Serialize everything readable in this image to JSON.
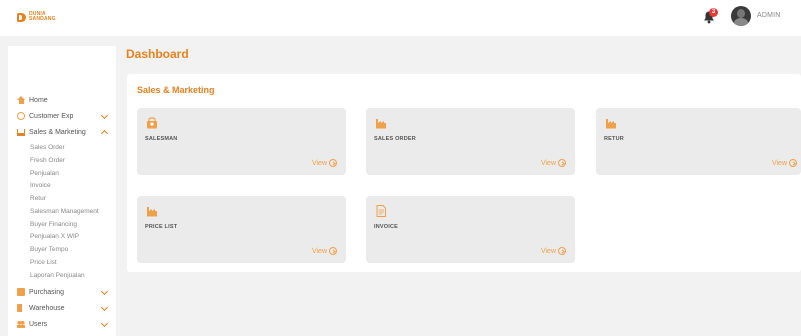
{
  "brand": {
    "line1": "DUNIA",
    "line2": "SANDANG",
    "accent": "#e8811f"
  },
  "header": {
    "notification_count": "3",
    "user_label": "ADMIN"
  },
  "sidebar": {
    "items": [
      {
        "label": "Home",
        "icon": "home-icon"
      },
      {
        "label": "Customer Exp",
        "icon": "customer-icon"
      },
      {
        "label": "Sales & Marketing",
        "icon": "cart-icon"
      },
      {
        "label": "Purchasing",
        "icon": "purchasing-icon"
      },
      {
        "label": "Warehouse",
        "icon": "truck-icon"
      },
      {
        "label": "Users",
        "icon": "users-icon"
      }
    ],
    "sub_items": [
      "Sales Order",
      "Fresh Order",
      "Penjualan",
      "Invoice",
      "Retur",
      "Salesman Management",
      "Buyer Financing",
      "Penjualan X WIP",
      "Buyer Tempo",
      "Price List",
      "Laporan Penjualan"
    ]
  },
  "main": {
    "title": "Dashboard",
    "section_title": "Sales & Marketing",
    "cards": [
      {
        "label": "SALESMAN",
        "view": "View",
        "icon": "salesman-icon"
      },
      {
        "label": "SALES ORDER",
        "view": "View",
        "icon": "factory-icon"
      },
      {
        "label": "RETUR",
        "view": "View",
        "icon": "factory-icon"
      },
      {
        "label": "PRICE LIST",
        "view": "View",
        "icon": "factory-icon"
      },
      {
        "label": "INVOICE",
        "view": "View",
        "icon": "document-icon"
      }
    ]
  }
}
